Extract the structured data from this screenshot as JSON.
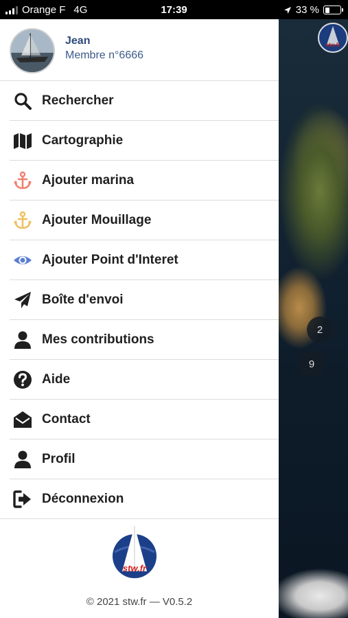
{
  "status_bar": {
    "carrier": "Orange F",
    "network": "4G",
    "time": "17:39",
    "battery": "33 %",
    "battery_level": 0.33
  },
  "user": {
    "name": "Jean",
    "member": "Membre n°6666"
  },
  "menu": {
    "items": [
      {
        "label": "Rechercher",
        "icon": "search-icon",
        "color": "#1f1f1f"
      },
      {
        "label": "Cartographie",
        "icon": "map-icon",
        "color": "#1f1f1f"
      },
      {
        "label": "Ajouter marina",
        "icon": "anchor-icon",
        "color": "#f08070"
      },
      {
        "label": "Ajouter Mouillage",
        "icon": "anchor-icon",
        "color": "#f0c060"
      },
      {
        "label": "Ajouter Point d'Interet",
        "icon": "eye-icon",
        "color": "#5b7fd0"
      },
      {
        "label": "Boîte d'envoi",
        "icon": "paper-plane-icon",
        "color": "#1f1f1f"
      },
      {
        "label": "Mes contributions",
        "icon": "user-icon",
        "color": "#1f1f1f"
      },
      {
        "label": "Aide",
        "icon": "question-circle-icon",
        "color": "#1f1f1f"
      },
      {
        "label": "Contact",
        "icon": "envelope-open-icon",
        "color": "#1f1f1f"
      },
      {
        "label": "Profil",
        "icon": "user-icon",
        "color": "#1f1f1f"
      },
      {
        "label": "Déconnexion",
        "icon": "sign-out-icon",
        "color": "#1f1f1f"
      }
    ]
  },
  "footer": {
    "logo_text": "stw.fr",
    "copyright": "© 2021 stw.fr — V0.5.2"
  },
  "map": {
    "logo_text": "stw.fr",
    "clusters": [
      "2",
      "9"
    ]
  }
}
